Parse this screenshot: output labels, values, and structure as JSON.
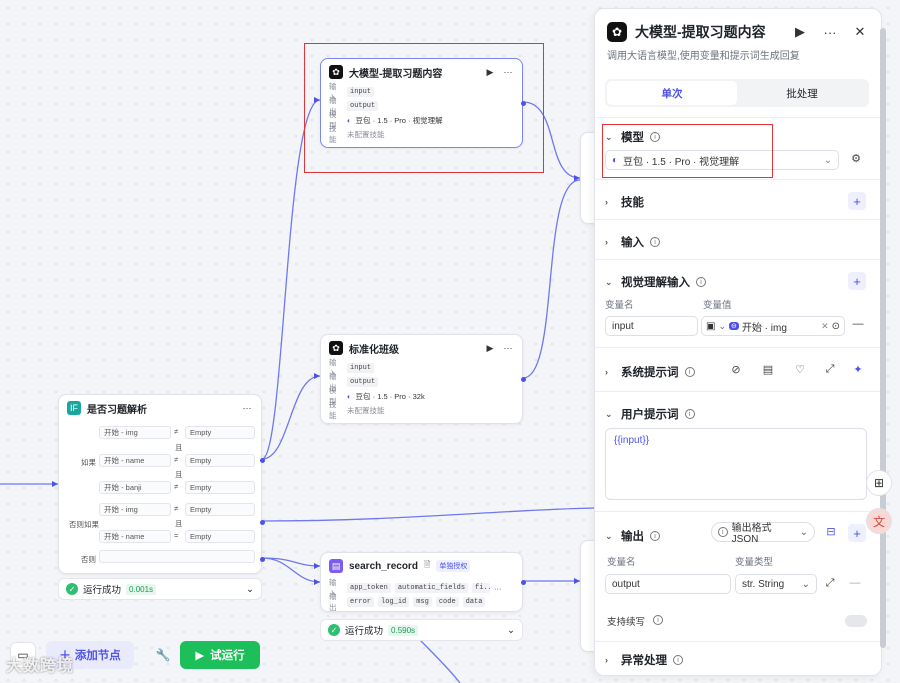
{
  "canvas": {
    "node_llm_extract": {
      "title": "大模型-提取习题内容",
      "rows": [
        {
          "label": "输入",
          "chip": "input"
        },
        {
          "label": "输出",
          "chip": "output"
        },
        {
          "label": "模型",
          "value": "豆包 · 1.5 · Pro · 视觉理解"
        },
        {
          "label": "技能",
          "value": "未配置技能"
        }
      ]
    },
    "node_normalize": {
      "title": "标准化班级",
      "rows": [
        {
          "label": "输入",
          "chip": "input"
        },
        {
          "label": "输出",
          "chip": "output"
        },
        {
          "label": "模型",
          "value": "豆包 · 1.5 · Pro · 32k"
        },
        {
          "label": "技能",
          "value": "未配置技能"
        }
      ]
    },
    "node_condition": {
      "title": "是否习题解析",
      "if_label": "如果",
      "elseif_label": "否则如果",
      "else_label": "否则",
      "and_label": "且",
      "conditions": [
        {
          "left": "开始 - img",
          "op": "≠",
          "right": "Empty"
        },
        {
          "left": "开始 - name",
          "op": "≠",
          "right": "Empty"
        },
        {
          "left": "开始 - banji",
          "op": "≠",
          "right": "Empty"
        },
        {
          "left": "开始 - img",
          "op": "≠",
          "right": "Empty"
        },
        {
          "left": "开始 - name",
          "op": "=",
          "right": "Empty"
        }
      ],
      "status": "运行成功",
      "duration": "0.001s"
    },
    "node_search": {
      "title": "search_record",
      "badge": "单独授权",
      "input_label": "输入",
      "output_label": "输出",
      "inputs": [
        "app_token",
        "automatic_fields",
        "fi..."
      ],
      "outputs": [
        "error",
        "log_id",
        "msg",
        "code",
        "data"
      ],
      "status": "运行成功",
      "duration": "0.590s"
    },
    "add_node": "添加节点",
    "run": "试运行",
    "watermark": "大数跨境"
  },
  "panel": {
    "title": "大模型-提取习题内容",
    "desc": "调用大语言模型,使用变量和提示词生成回复",
    "tabs": [
      "单次",
      "批处理"
    ],
    "model_section": "模型",
    "model_value": "豆包 · 1.5 · Pro · 视觉理解",
    "skills_section": "技能",
    "input_section": "输入",
    "vision_section": "视觉理解输入",
    "var_name_label": "变量名",
    "var_value_label": "变量值",
    "vision_var_name": "input",
    "vision_var_value": "开始 · img",
    "system_prompt_section": "系统提示词",
    "user_prompt_section": "用户提示词",
    "user_prompt_value": "{{input}}",
    "output_section": "输出",
    "output_format": "输出格式JSON",
    "out_var_name_label": "变量名",
    "out_var_type_label": "变量类型",
    "out_var_name": "output",
    "out_var_type": "str. String",
    "stream_label": "支持续写",
    "error_section": "异常处理"
  },
  "colors": {
    "accent": "#4d53e8",
    "success": "#1dbf5a",
    "highlight": "#e0363a"
  }
}
